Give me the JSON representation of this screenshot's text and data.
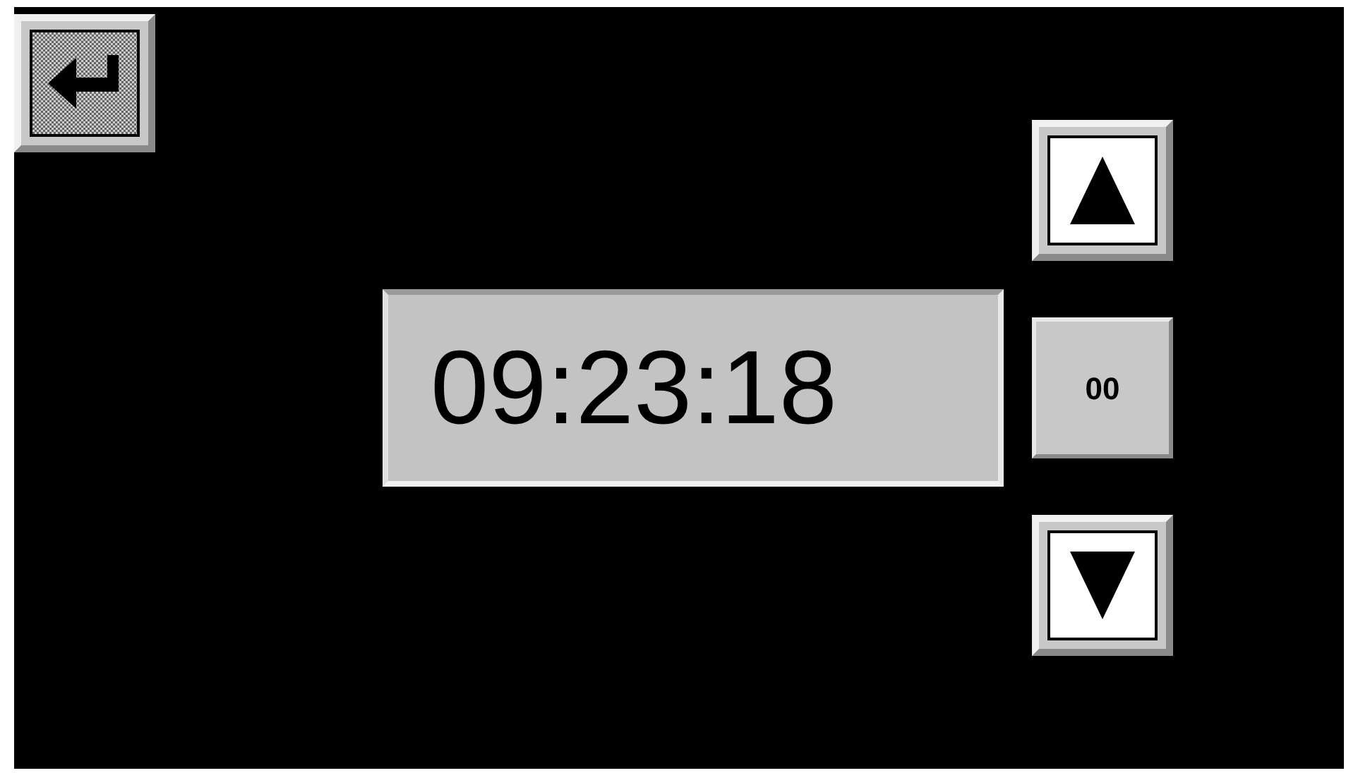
{
  "time_display": {
    "value": "09:23:18"
  },
  "reset_button": {
    "label": "00"
  }
}
